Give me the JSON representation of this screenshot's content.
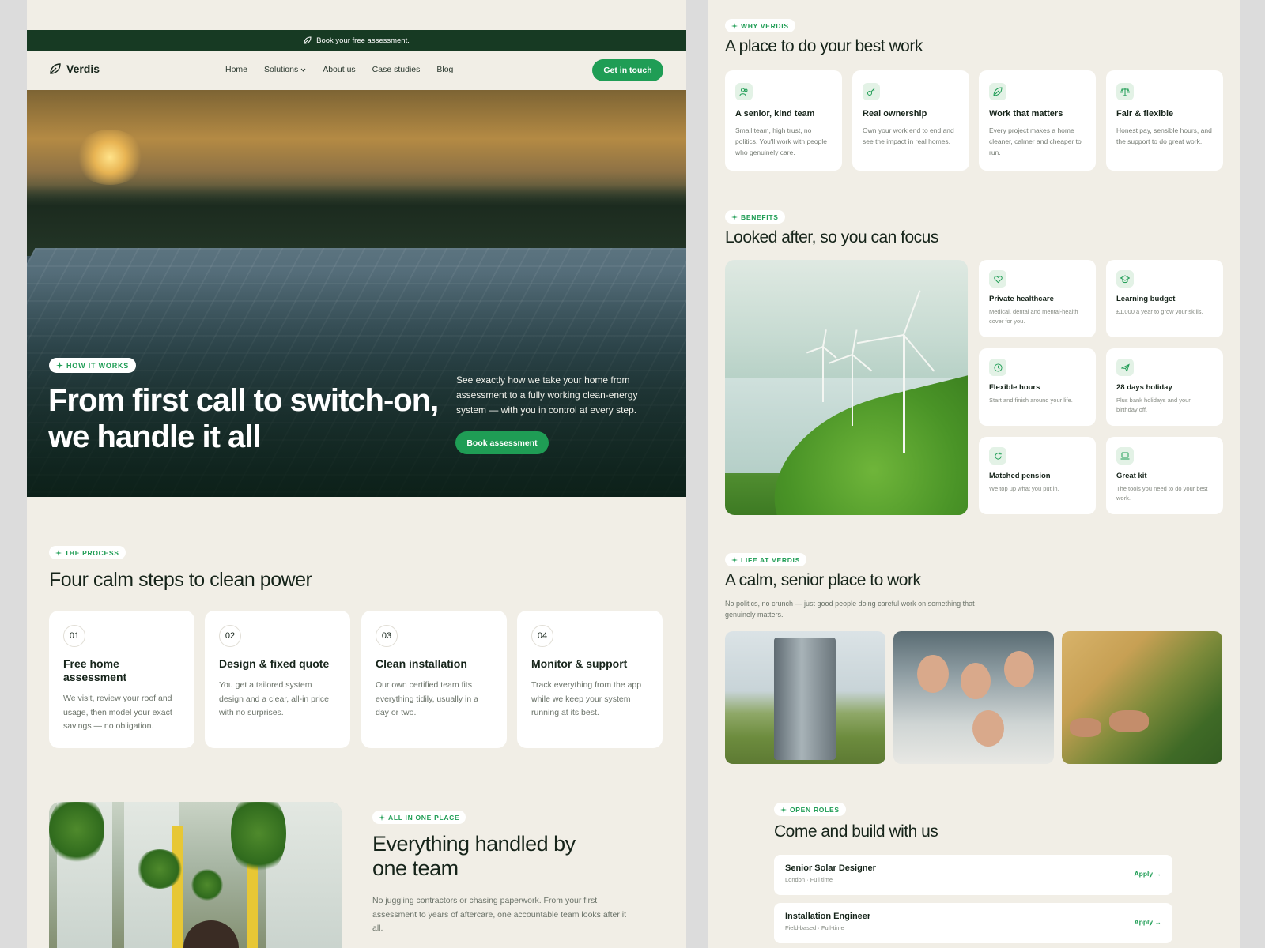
{
  "announcement": {
    "text": "Book your free assessment."
  },
  "nav": {
    "brand": "Verdis",
    "links": [
      "Home",
      "Solutions",
      "About us",
      "Case studies",
      "Blog"
    ],
    "cta": "Get in touch"
  },
  "hero": {
    "badge": "HOW IT WORKS",
    "title": "From first call to switch-on, we handle it all",
    "description": "See exactly how we take your home from assessment to a fully working clean-energy system — with you in control at every step.",
    "button": "Book assessment"
  },
  "process": {
    "badge": "THE PROCESS",
    "title": "Four calm steps to clean power",
    "steps": [
      {
        "num": "01",
        "title": "Free home assessment",
        "desc": "We visit, review your roof and usage, then model your exact savings — no obligation."
      },
      {
        "num": "02",
        "title": "Design & fixed quote",
        "desc": "You get a tailored system design and a clear, all-in price with no surprises."
      },
      {
        "num": "03",
        "title": "Clean installation",
        "desc": "Our own certified team fits everything tidily, usually in a day or two."
      },
      {
        "num": "04",
        "title": "Monitor & support",
        "desc": "Track everything from the app while we keep your system running at its best."
      }
    ]
  },
  "all_in_one": {
    "badge": "ALL IN ONE PLACE",
    "title": "Everything handled by one team",
    "desc": "No juggling contractors or chasing paperwork. From your first assessment to years of aftercare, one accountable team looks after it all."
  },
  "why": {
    "badge": "WHY VERDIS",
    "title": "A place to do your best work",
    "cards": [
      {
        "icon": "team-icon",
        "title": "A senior, kind team",
        "desc": "Small team, high trust, no politics. You'll work with people who genuinely care."
      },
      {
        "icon": "key-icon",
        "title": "Real ownership",
        "desc": "Own your work end to end and see the impact in real homes."
      },
      {
        "icon": "leaf-icon",
        "title": "Work that matters",
        "desc": "Every project makes a home cleaner, calmer and cheaper to run."
      },
      {
        "icon": "scale-icon",
        "title": "Fair & flexible",
        "desc": "Honest pay, sensible hours, and the support to do great work."
      }
    ]
  },
  "benefits": {
    "badge": "BENEFITS",
    "title": "Looked after, so you can focus",
    "cards": [
      {
        "icon": "heart-icon",
        "title": "Private healthcare",
        "desc": "Medical, dental and mental-health cover for you."
      },
      {
        "icon": "graduation-icon",
        "title": "Learning budget",
        "desc": "£1,000 a year to grow your skills."
      },
      {
        "icon": "clock-icon",
        "title": "Flexible hours",
        "desc": "Start and finish around your life."
      },
      {
        "icon": "plane-icon",
        "title": "28 days holiday",
        "desc": "Plus bank holidays and your birthday off."
      },
      {
        "icon": "refresh-icon",
        "title": "Matched pension",
        "desc": "We top up what you put in."
      },
      {
        "icon": "laptop-icon",
        "title": "Great kit",
        "desc": "The tools you need to do your best work."
      }
    ]
  },
  "life": {
    "badge": "LIFE AT VERDIS",
    "title": "A calm, senior place to work",
    "desc": "No politics, no crunch — just good people doing careful work on something that genuinely matters."
  },
  "roles": {
    "badge": "OPEN ROLES",
    "title": "Come and build with us",
    "items": [
      {
        "title": "Senior Solar Designer",
        "location": "London",
        "type": "Full time",
        "apply": "Apply →"
      },
      {
        "title": "Installation Engineer",
        "location": "Field-based",
        "type": "Full-time",
        "apply": "Apply →"
      }
    ]
  },
  "colors": {
    "accent": "#1f9d55",
    "dark": "#173a23",
    "background": "#f1eee6"
  }
}
